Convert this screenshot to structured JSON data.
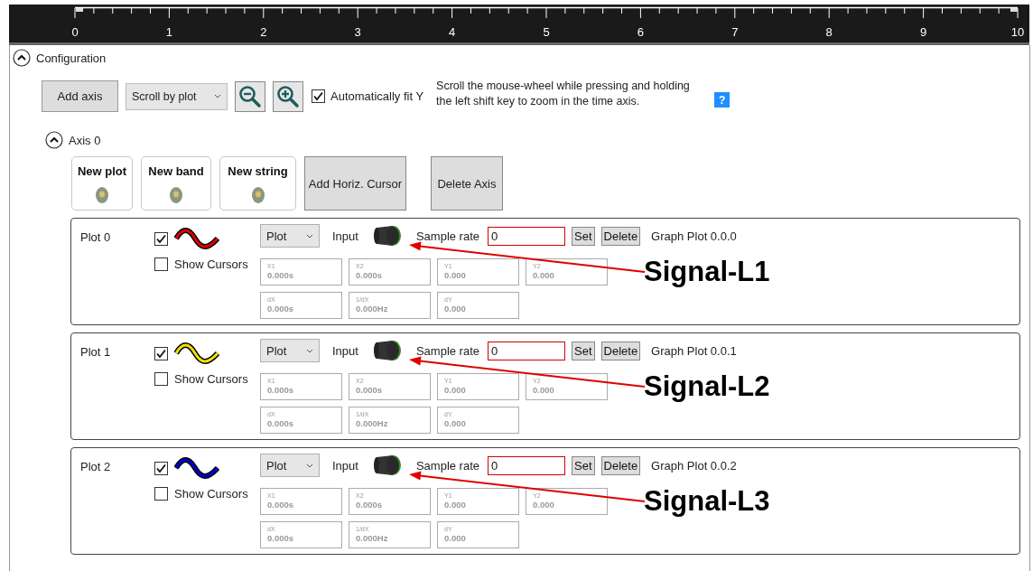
{
  "ruler": {
    "labels": [
      "0",
      "1",
      "2",
      "3",
      "4",
      "5",
      "6",
      "7",
      "8",
      "9",
      "10"
    ]
  },
  "configuration": {
    "label": "Configuration",
    "expanded": true,
    "add_axis": "Add axis",
    "scroll_mode": "Scroll by plot",
    "auto_fit": {
      "label": "Automatically fit Y",
      "checked": true
    },
    "hint": "Scroll the mouse-wheel while pressing and holding the left shift key to zoom in the time axis.",
    "help": "?"
  },
  "axis": {
    "label": "Axis 0",
    "expanded": true,
    "new_buttons": [
      "New plot",
      "New band",
      "New string"
    ],
    "buttons": [
      "Add Horiz. Cursor",
      "Delete Axis"
    ]
  },
  "plots": [
    {
      "name": "Plot 0",
      "visible": true,
      "color": "#e00000",
      "show_cursors": {
        "label": "Show Cursors",
        "checked": false
      },
      "type": "Plot",
      "input": "Input",
      "sample_rate_label": "Sample rate",
      "sample_rate": "0",
      "set": "Set",
      "delete": "Delete",
      "graph": "Graph Plot 0.0.0",
      "cursors": [
        {
          "label": "X1",
          "value": "0.000s"
        },
        {
          "label": "X2",
          "value": "0.000s"
        },
        {
          "label": "Y1",
          "value": "0.000"
        },
        {
          "label": "Y2",
          "value": "0.000"
        },
        {
          "label": "dX",
          "value": "0.000s"
        },
        {
          "label": "1/dX",
          "value": "0.000Hz"
        },
        {
          "label": "dY",
          "value": "0.000"
        }
      ],
      "annotation": "Signal-L1"
    },
    {
      "name": "Plot 1",
      "visible": true,
      "color": "#f0e000",
      "show_cursors": {
        "label": "Show Cursors",
        "checked": false
      },
      "type": "Plot",
      "input": "Input",
      "sample_rate_label": "Sample rate",
      "sample_rate": "0",
      "set": "Set",
      "delete": "Delete",
      "graph": "Graph Plot 0.0.1",
      "cursors": [
        {
          "label": "X1",
          "value": "0.000s"
        },
        {
          "label": "X2",
          "value": "0.000s"
        },
        {
          "label": "Y1",
          "value": "0.000"
        },
        {
          "label": "Y2",
          "value": "0.000"
        },
        {
          "label": "dX",
          "value": "0.000s"
        },
        {
          "label": "1/dX",
          "value": "0.000Hz"
        },
        {
          "label": "dY",
          "value": "0.000"
        }
      ],
      "annotation": "Signal-L2"
    },
    {
      "name": "Plot 2",
      "visible": true,
      "color": "#0000d0",
      "show_cursors": {
        "label": "Show Cursors",
        "checked": false
      },
      "type": "Plot",
      "input": "Input",
      "sample_rate_label": "Sample rate",
      "sample_rate": "0",
      "set": "Set",
      "delete": "Delete",
      "graph": "Graph Plot 0.0.2",
      "cursors": [
        {
          "label": "X1",
          "value": "0.000s"
        },
        {
          "label": "X2",
          "value": "0.000s"
        },
        {
          "label": "Y1",
          "value": "0.000"
        },
        {
          "label": "Y2",
          "value": "0.000"
        },
        {
          "label": "dX",
          "value": "0.000s"
        },
        {
          "label": "1/dX",
          "value": "0.000Hz"
        },
        {
          "label": "dY",
          "value": "0.000"
        }
      ],
      "annotation": "Signal-L3"
    }
  ]
}
